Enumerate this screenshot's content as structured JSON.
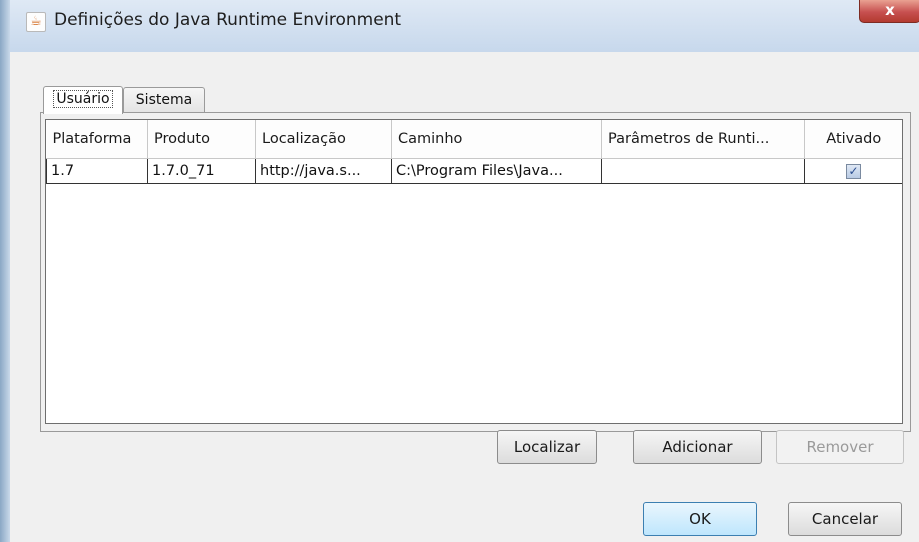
{
  "window": {
    "title": "Definições do Java Runtime Environment",
    "close_label": "x",
    "icon": "java-icon"
  },
  "tabs": [
    {
      "label": "Usuário",
      "active": true
    },
    {
      "label": "Sistema",
      "active": false
    }
  ],
  "table": {
    "columns": [
      "Plataforma",
      "Produto",
      "Localização",
      "Caminho",
      "Parâmetros de Runti...",
      "Ativado"
    ],
    "rows": [
      {
        "plataforma": "1.7",
        "produto": "1.7.0_71",
        "localizacao": "http://java.s...",
        "caminho": "C:\\Program Files\\Java...",
        "parametros": "",
        "ativado": true
      }
    ]
  },
  "table_buttons": {
    "localizar": "Localizar",
    "adicionar": "Adicionar",
    "remover": "Remover"
  },
  "dialog_buttons": {
    "ok": "OK",
    "cancelar": "Cancelar"
  },
  "colors": {
    "accent": "#3c7fb1",
    "close": "#c75050"
  }
}
